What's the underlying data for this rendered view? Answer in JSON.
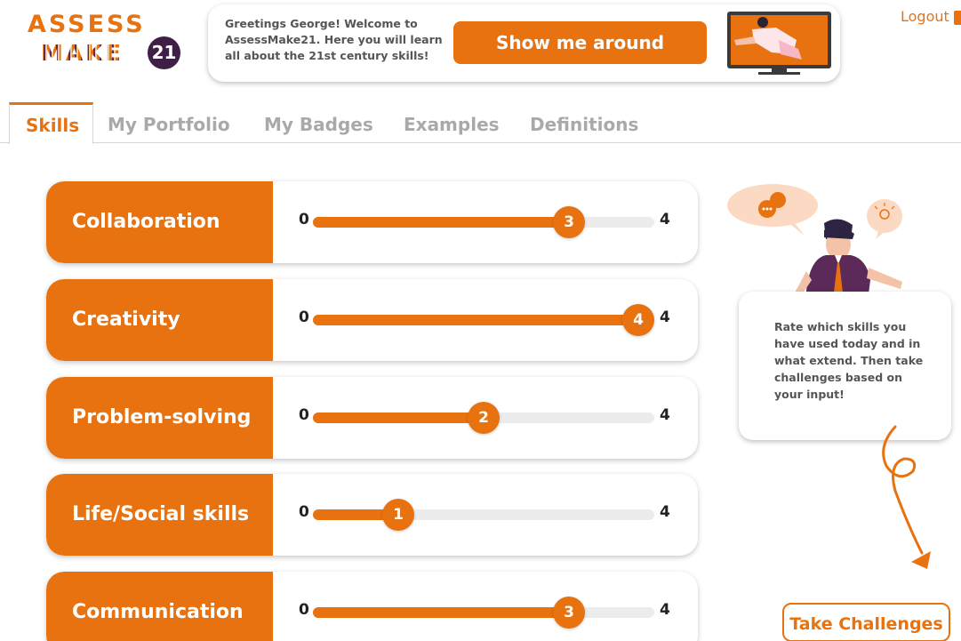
{
  "logo": {
    "line1": "ASSESS",
    "line2": "MAKE",
    "number": "21"
  },
  "greeting": {
    "message": "Greetings George! Welcome to AssessMake21. Here you will learn all about the 21st century skills!",
    "tour_button": "Show me around"
  },
  "header": {
    "logout_label": "Logout"
  },
  "tabs": [
    {
      "label": "Skills",
      "active": true
    },
    {
      "label": "My Portfolio",
      "active": false
    },
    {
      "label": "My Badges",
      "active": false
    },
    {
      "label": "Examples",
      "active": false
    },
    {
      "label": "Definitions",
      "active": false
    }
  ],
  "skills": [
    {
      "name": "Collaboration",
      "min": "0",
      "max": "4",
      "value": "3",
      "fraction": 0.75
    },
    {
      "name": "Creativity",
      "min": "0",
      "max": "4",
      "value": "4",
      "fraction": 1.0
    },
    {
      "name": "Problem-solving",
      "min": "0",
      "max": "4",
      "value": "2",
      "fraction": 0.5
    },
    {
      "name": "Life/Social skills",
      "min": "0",
      "max": "4",
      "value": "1",
      "fraction": 0.25
    },
    {
      "name": "Communication",
      "min": "0",
      "max": "4",
      "value": "3",
      "fraction": 0.75
    }
  ],
  "helper": {
    "tip_text": "Rate which skills you have used today and in what extend. Then take challenges based on your input!",
    "challenge_button": "Take Challenges"
  },
  "colors": {
    "accent": "#e8720f",
    "dark": "#3f1f45",
    "track": "#ececec"
  }
}
